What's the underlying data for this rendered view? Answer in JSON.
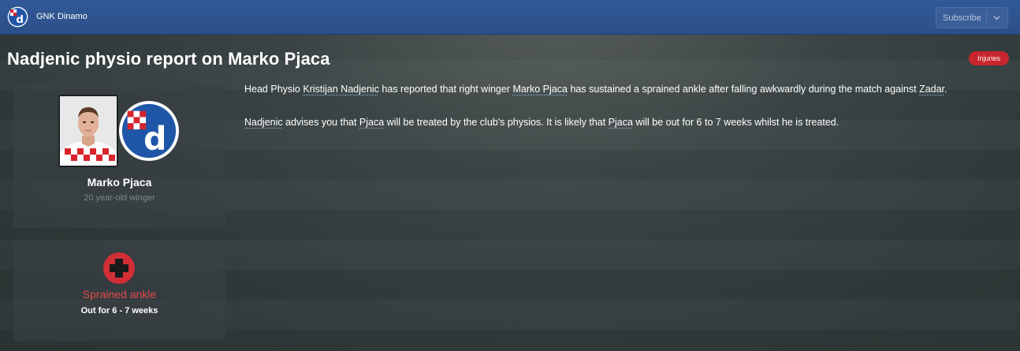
{
  "header": {
    "club_name": "GNK Dinamo",
    "subscribe_label": "Subscribe"
  },
  "page_title": "Nadjenic physio report on Marko Pjaca",
  "tag": "Injuries",
  "player": {
    "name": "Marko Pjaca",
    "description": "20 year-old winger"
  },
  "injury": {
    "name": "Sprained ankle",
    "duration": "Out for 6 - 7 weeks"
  },
  "report": {
    "p1": {
      "t1": "Head Physio ",
      "l1": "Kristijan Nadjenic",
      "t2": " has reported that right winger ",
      "l2": "Marko Pjaca",
      "t3": " has sustained a sprained ankle after falling awkwardly during the match against ",
      "l3": "Zadar",
      "t4": "."
    },
    "p2": {
      "l1": "Nadjenic",
      "t1": " advises you that ",
      "l2": "Pjaca",
      "t2": " will be treated by the club's physios. It is likely that ",
      "l3": "Pjaca",
      "t3": " will be out for 6 to 7 weeks whilst he is treated."
    }
  },
  "colors": {
    "topbar": "#2d5390",
    "tag_bg": "#c8252d",
    "injury_text": "#e24a4a",
    "injury_icon": "#d12f35"
  },
  "icons": {
    "club_badge": "dinamo-crest-icon",
    "dropdown": "chevron-down-icon",
    "injury": "medical-cross-icon"
  }
}
